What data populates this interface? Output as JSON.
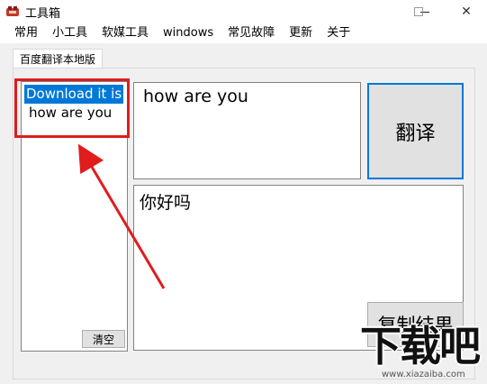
{
  "window": {
    "title": "工具箱",
    "min_symbol": "—",
    "close_symbol": "✕"
  },
  "menubar": {
    "items": [
      "常用",
      "小工具",
      "软媒工具",
      "windows",
      "常见故障",
      "更新",
      "关于"
    ]
  },
  "tab": {
    "label": "百度翻译本地版"
  },
  "history_list": {
    "items": [
      "Download it is",
      "how are you"
    ],
    "clear_label": "清空"
  },
  "input": {
    "value": "how are you"
  },
  "translate_button": {
    "label": "翻译"
  },
  "output": {
    "value": "你好吗"
  },
  "copy_button": {
    "label": "复制结果"
  },
  "watermark": {
    "text": "下载吧",
    "url": "www.xiazaiba.com"
  },
  "colors": {
    "selection": "#0078d7",
    "highlight_box": "#e01c1c",
    "arrow": "#e01c1c"
  }
}
